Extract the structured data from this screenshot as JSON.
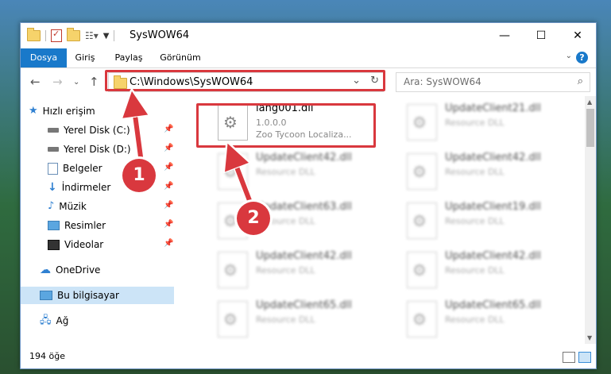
{
  "window": {
    "title": "SysWOW64",
    "controls": {
      "minimize": "—",
      "maximize": "☐",
      "close": "✕"
    }
  },
  "ribbon": {
    "tabs": [
      "Dosya",
      "Giriş",
      "Paylaş",
      "Görünüm"
    ],
    "help": "?"
  },
  "address": {
    "path": "C:\\Windows\\SysWOW64",
    "search_placeholder": "Ara: SysWOW64"
  },
  "nav_pane": {
    "items": [
      {
        "label": "Hızlı erişim",
        "icon": "star-icon",
        "pinned": false
      },
      {
        "label": "Yerel Disk (C:)",
        "icon": "drive-icon",
        "pinned": true
      },
      {
        "label": "Yerel Disk (D:)",
        "icon": "drive-icon",
        "pinned": true
      },
      {
        "label": "Belgeler",
        "icon": "documents-icon",
        "pinned": true
      },
      {
        "label": "İndirmeler",
        "icon": "download-icon",
        "pinned": true
      },
      {
        "label": "Müzik",
        "icon": "music-icon",
        "pinned": true
      },
      {
        "label": "Resimler",
        "icon": "pictures-icon",
        "pinned": true
      },
      {
        "label": "Videolar",
        "icon": "videos-icon",
        "pinned": true
      },
      {
        "label": "OneDrive",
        "icon": "cloud-icon",
        "pinned": false
      },
      {
        "label": "Bu bilgisayar",
        "icon": "computer-icon",
        "pinned": false,
        "selected": true
      },
      {
        "label": "Ağ",
        "icon": "network-icon",
        "pinned": false
      }
    ]
  },
  "files": [
    {
      "name": "lang001.dll",
      "line2": "1.0.0.0",
      "line3": "Zoo Tycoon Localiza...",
      "highlight": true
    },
    {
      "name": "UpdateClient21.dll",
      "line2": "Resource DLL",
      "line3": ""
    },
    {
      "name": "UpdateClient42.dll",
      "line2": "Resource DLL",
      "line3": ""
    },
    {
      "name": "UpdateClient42.dll",
      "line2": "Resource DLL",
      "line3": ""
    },
    {
      "name": "UpdateClient63.dll",
      "line2": "Resource DLL",
      "line3": ""
    },
    {
      "name": "UpdateClient19.dll",
      "line2": "Resource DLL",
      "line3": ""
    },
    {
      "name": "UpdateClient42.dll",
      "line2": "Resource DLL",
      "line3": ""
    },
    {
      "name": "UpdateClient42.dll",
      "line2": "Resource DLL",
      "line3": ""
    },
    {
      "name": "UpdateClient65.dll",
      "line2": "Resource DLL",
      "line3": ""
    },
    {
      "name": "UpdateClient65.dll",
      "line2": "Resource DLL",
      "line3": ""
    }
  ],
  "status": {
    "count": "194 öğe"
  },
  "callouts": {
    "step1": "1",
    "step2": "2"
  },
  "colors": {
    "accent": "#1979ca",
    "highlight": "#d9383e",
    "selected": "#cce4f7"
  }
}
